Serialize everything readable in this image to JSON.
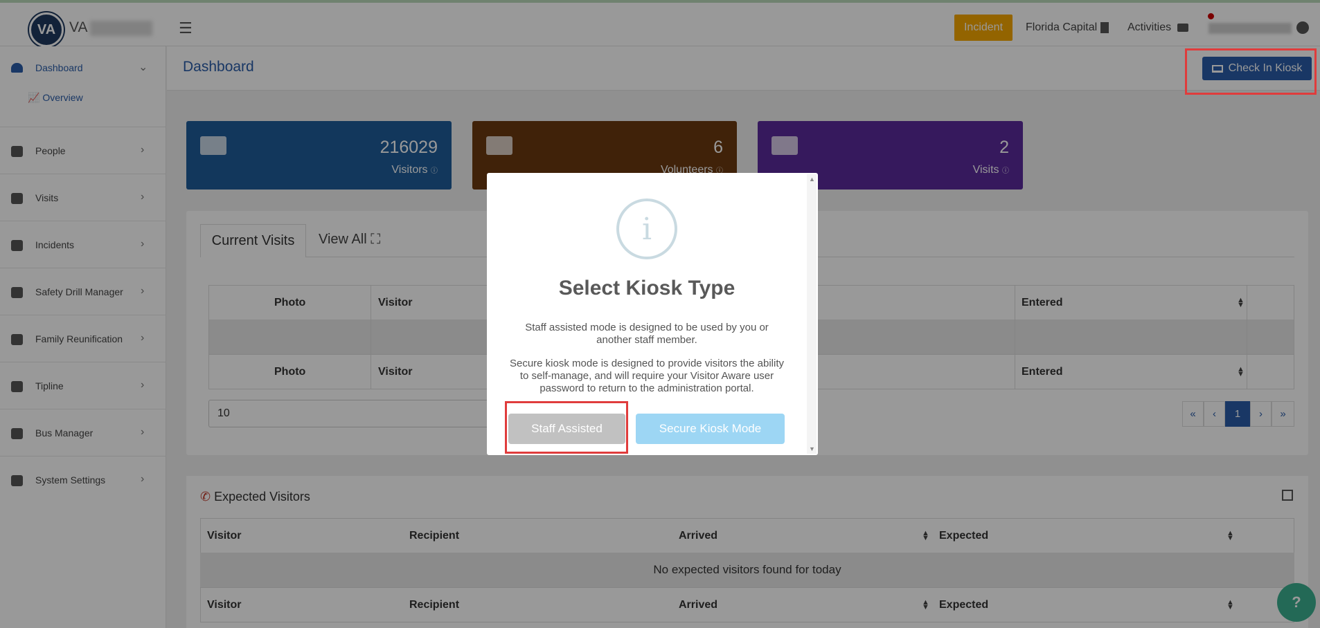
{
  "header": {
    "logo_text": "VA",
    "brand": "VA",
    "incident_label": "Incident",
    "school_name": "Florida Capital",
    "activities_label": "Activities"
  },
  "sidebar": {
    "dashboard": "Dashboard",
    "overview": "Overview",
    "items": [
      "People",
      "Visits",
      "Incidents",
      "Safety Drill Manager",
      "Family Reunification",
      "Tipline",
      "Bus Manager",
      "System Settings"
    ]
  },
  "page": {
    "title": "Dashboard",
    "kiosk_button": "Check In Kiosk"
  },
  "stats": {
    "visitors": {
      "value": "216029",
      "label": "Visitors"
    },
    "volunteers": {
      "value": "6",
      "label": "Volunteers"
    },
    "visits": {
      "value": "2",
      "label": "Visits"
    }
  },
  "current_visits": {
    "tab_active": "Current Visits",
    "tab_other": "View All",
    "columns": {
      "photo": "Photo",
      "visitor": "Visitor",
      "entered": "Entered"
    },
    "page_size": "10",
    "pager": {
      "first": "«",
      "prev": "‹",
      "current": "1",
      "next": "›",
      "last": "»"
    }
  },
  "expected_visitors": {
    "title": "Expected Visitors",
    "columns": {
      "visitor": "Visitor",
      "recipient": "Recipient",
      "arrived": "Arrived",
      "expected": "Expected"
    },
    "empty": "No expected visitors found for today"
  },
  "modal": {
    "icon": "i",
    "title": "Select Kiosk Type",
    "line1": "Staff assisted mode is designed to be used by you or",
    "line2": "another staff member.",
    "line3": "Secure kiosk mode is designed to provide visitors the ability",
    "line4": "to self-manage, and will require your Visitor Aware user",
    "line5": "password to return to the administration portal.",
    "staff_button": "Staff Assisted",
    "secure_button": "Secure Kiosk Mode"
  },
  "help": {
    "label": "?"
  }
}
